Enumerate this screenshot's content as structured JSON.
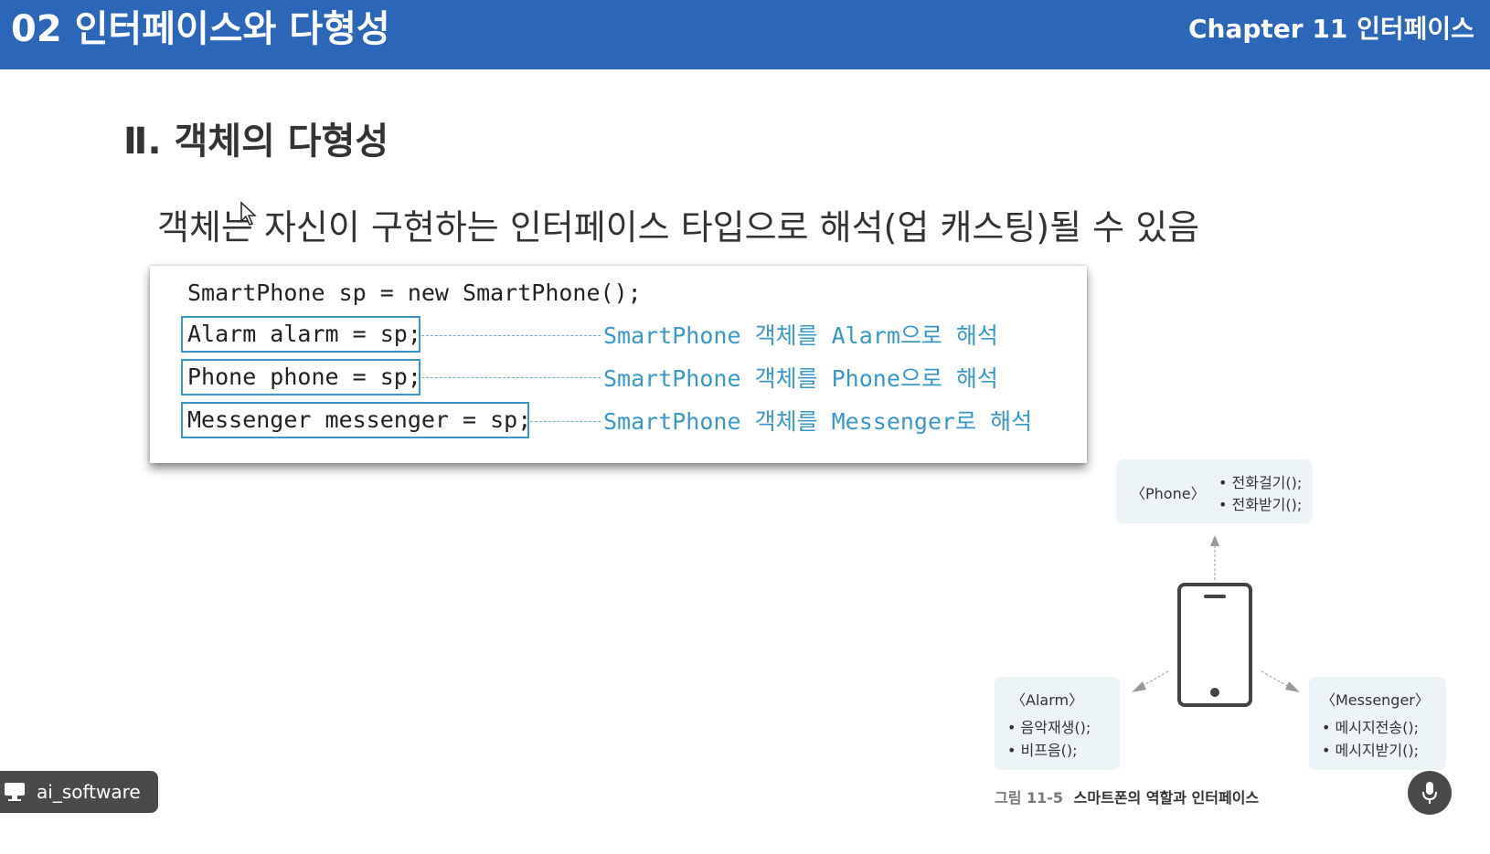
{
  "header": {
    "title": "02 인터페이스와 다형성",
    "chapter": "Chapter 11 인터페이스"
  },
  "section_title": "Ⅱ. 객체의 다형성",
  "description": "객체는 자신이 구현하는 인터페이스 타입으로 해석(업 캐스팅)될 수 있음",
  "code": {
    "line1": "SmartPhone sp = new SmartPhone();",
    "rows": [
      {
        "code": "Alarm alarm = sp;",
        "note": "SmartPhone 객체를 Alarm으로 해석"
      },
      {
        "code": "Phone phone = sp;",
        "note": "SmartPhone 객체를 Phone으로 해석"
      },
      {
        "code": "Messenger messenger = sp;",
        "note": "SmartPhone 객체를 Messenger로 해석"
      }
    ]
  },
  "diagram": {
    "phone": {
      "name": "〈Phone〉",
      "methods": [
        "• 전화걸기();",
        "• 전화받기();"
      ]
    },
    "alarm": {
      "name": "〈Alarm〉",
      "methods": [
        "• 음악재생();",
        "• 비프음();"
      ]
    },
    "messenger": {
      "name": "〈Messenger〉",
      "methods": [
        "• 메시지전송();",
        "• 메시지받기();"
      ]
    },
    "caption_number": "그림 11-5",
    "caption_text": "스마트폰의 역할과 인터페이스"
  },
  "overlay": {
    "user_name": "ai_software"
  },
  "colors": {
    "header_bg": "#2b66b8",
    "accent": "#3a97c9",
    "iface_bg": "#ecf4f8"
  }
}
